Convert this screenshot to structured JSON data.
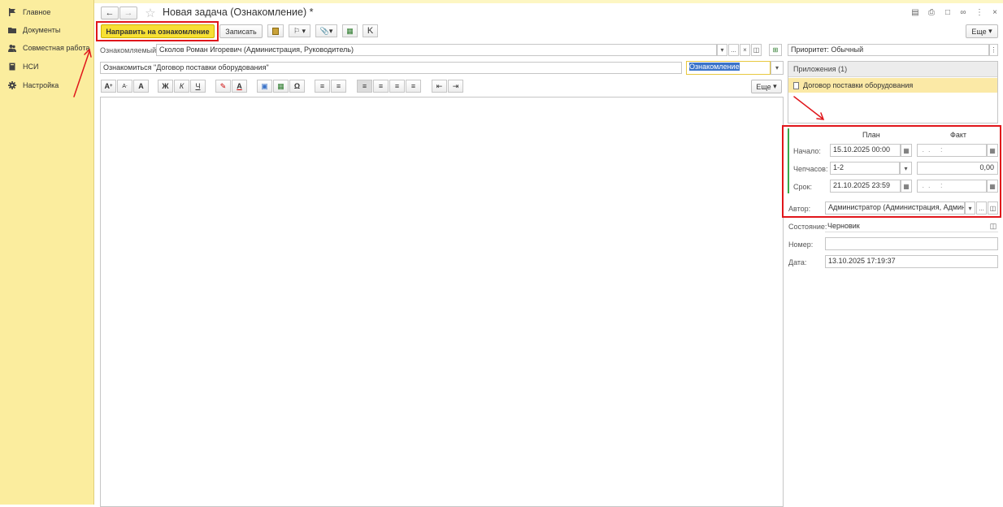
{
  "sidebar": {
    "items": [
      {
        "label": "Главное",
        "icon": "flag-icon"
      },
      {
        "label": "Документы",
        "icon": "folder-icon"
      },
      {
        "label": "Совместная работа",
        "icon": "people-icon"
      },
      {
        "label": "НСИ",
        "icon": "book-icon"
      },
      {
        "label": "Настройка",
        "icon": "gear-icon"
      }
    ]
  },
  "window": {
    "title": "Новая задача (Ознакомление) *"
  },
  "toolbar": {
    "send_label": "Направить на ознакомление",
    "save_label": "Записать",
    "more_label": "Еще"
  },
  "form": {
    "recipient_label": "Ознакомляемый:",
    "recipient_value": "Сколов Роман Игоревич (Администрация, Руководитель)",
    "priority_value": "Приоритет: Обычный",
    "subject_value": "Ознакомиться \"Договор поставки оборудования\"",
    "type_value": "Ознакомление",
    "editor_more_label": "Еще"
  },
  "attachments": {
    "header": "Приложения (1)",
    "items": [
      "Договор поставки оборудования"
    ]
  },
  "schedule": {
    "plan_header": "План",
    "fact_header": "Факт",
    "start_label": "Начало:",
    "start_plan": "15.10.2025 00:00",
    "start_fact": " .  .     :",
    "hours_label": "Чепчасов:",
    "hours_plan": "1-2",
    "hours_fact": "0,00",
    "due_label": "Срок:",
    "due_plan": "21.10.2025 23:59",
    "due_fact": " .  .     :",
    "author_label": "Автор:",
    "author_value": "Администратор (Администрация, Админис"
  },
  "details": {
    "state_label": "Состояние:",
    "state_value": "Черновик",
    "number_label": "Номер:",
    "number_value": "",
    "date_label": "Дата:",
    "date_value": "13.10.2025 17:19:37"
  },
  "colors": {
    "sidebar_bg": "#fbed9e",
    "primary_button": "#f7e034",
    "highlight_red": "#e0161b",
    "attachment_selected": "#fbe9a6",
    "type_field_border": "#e8c840"
  }
}
